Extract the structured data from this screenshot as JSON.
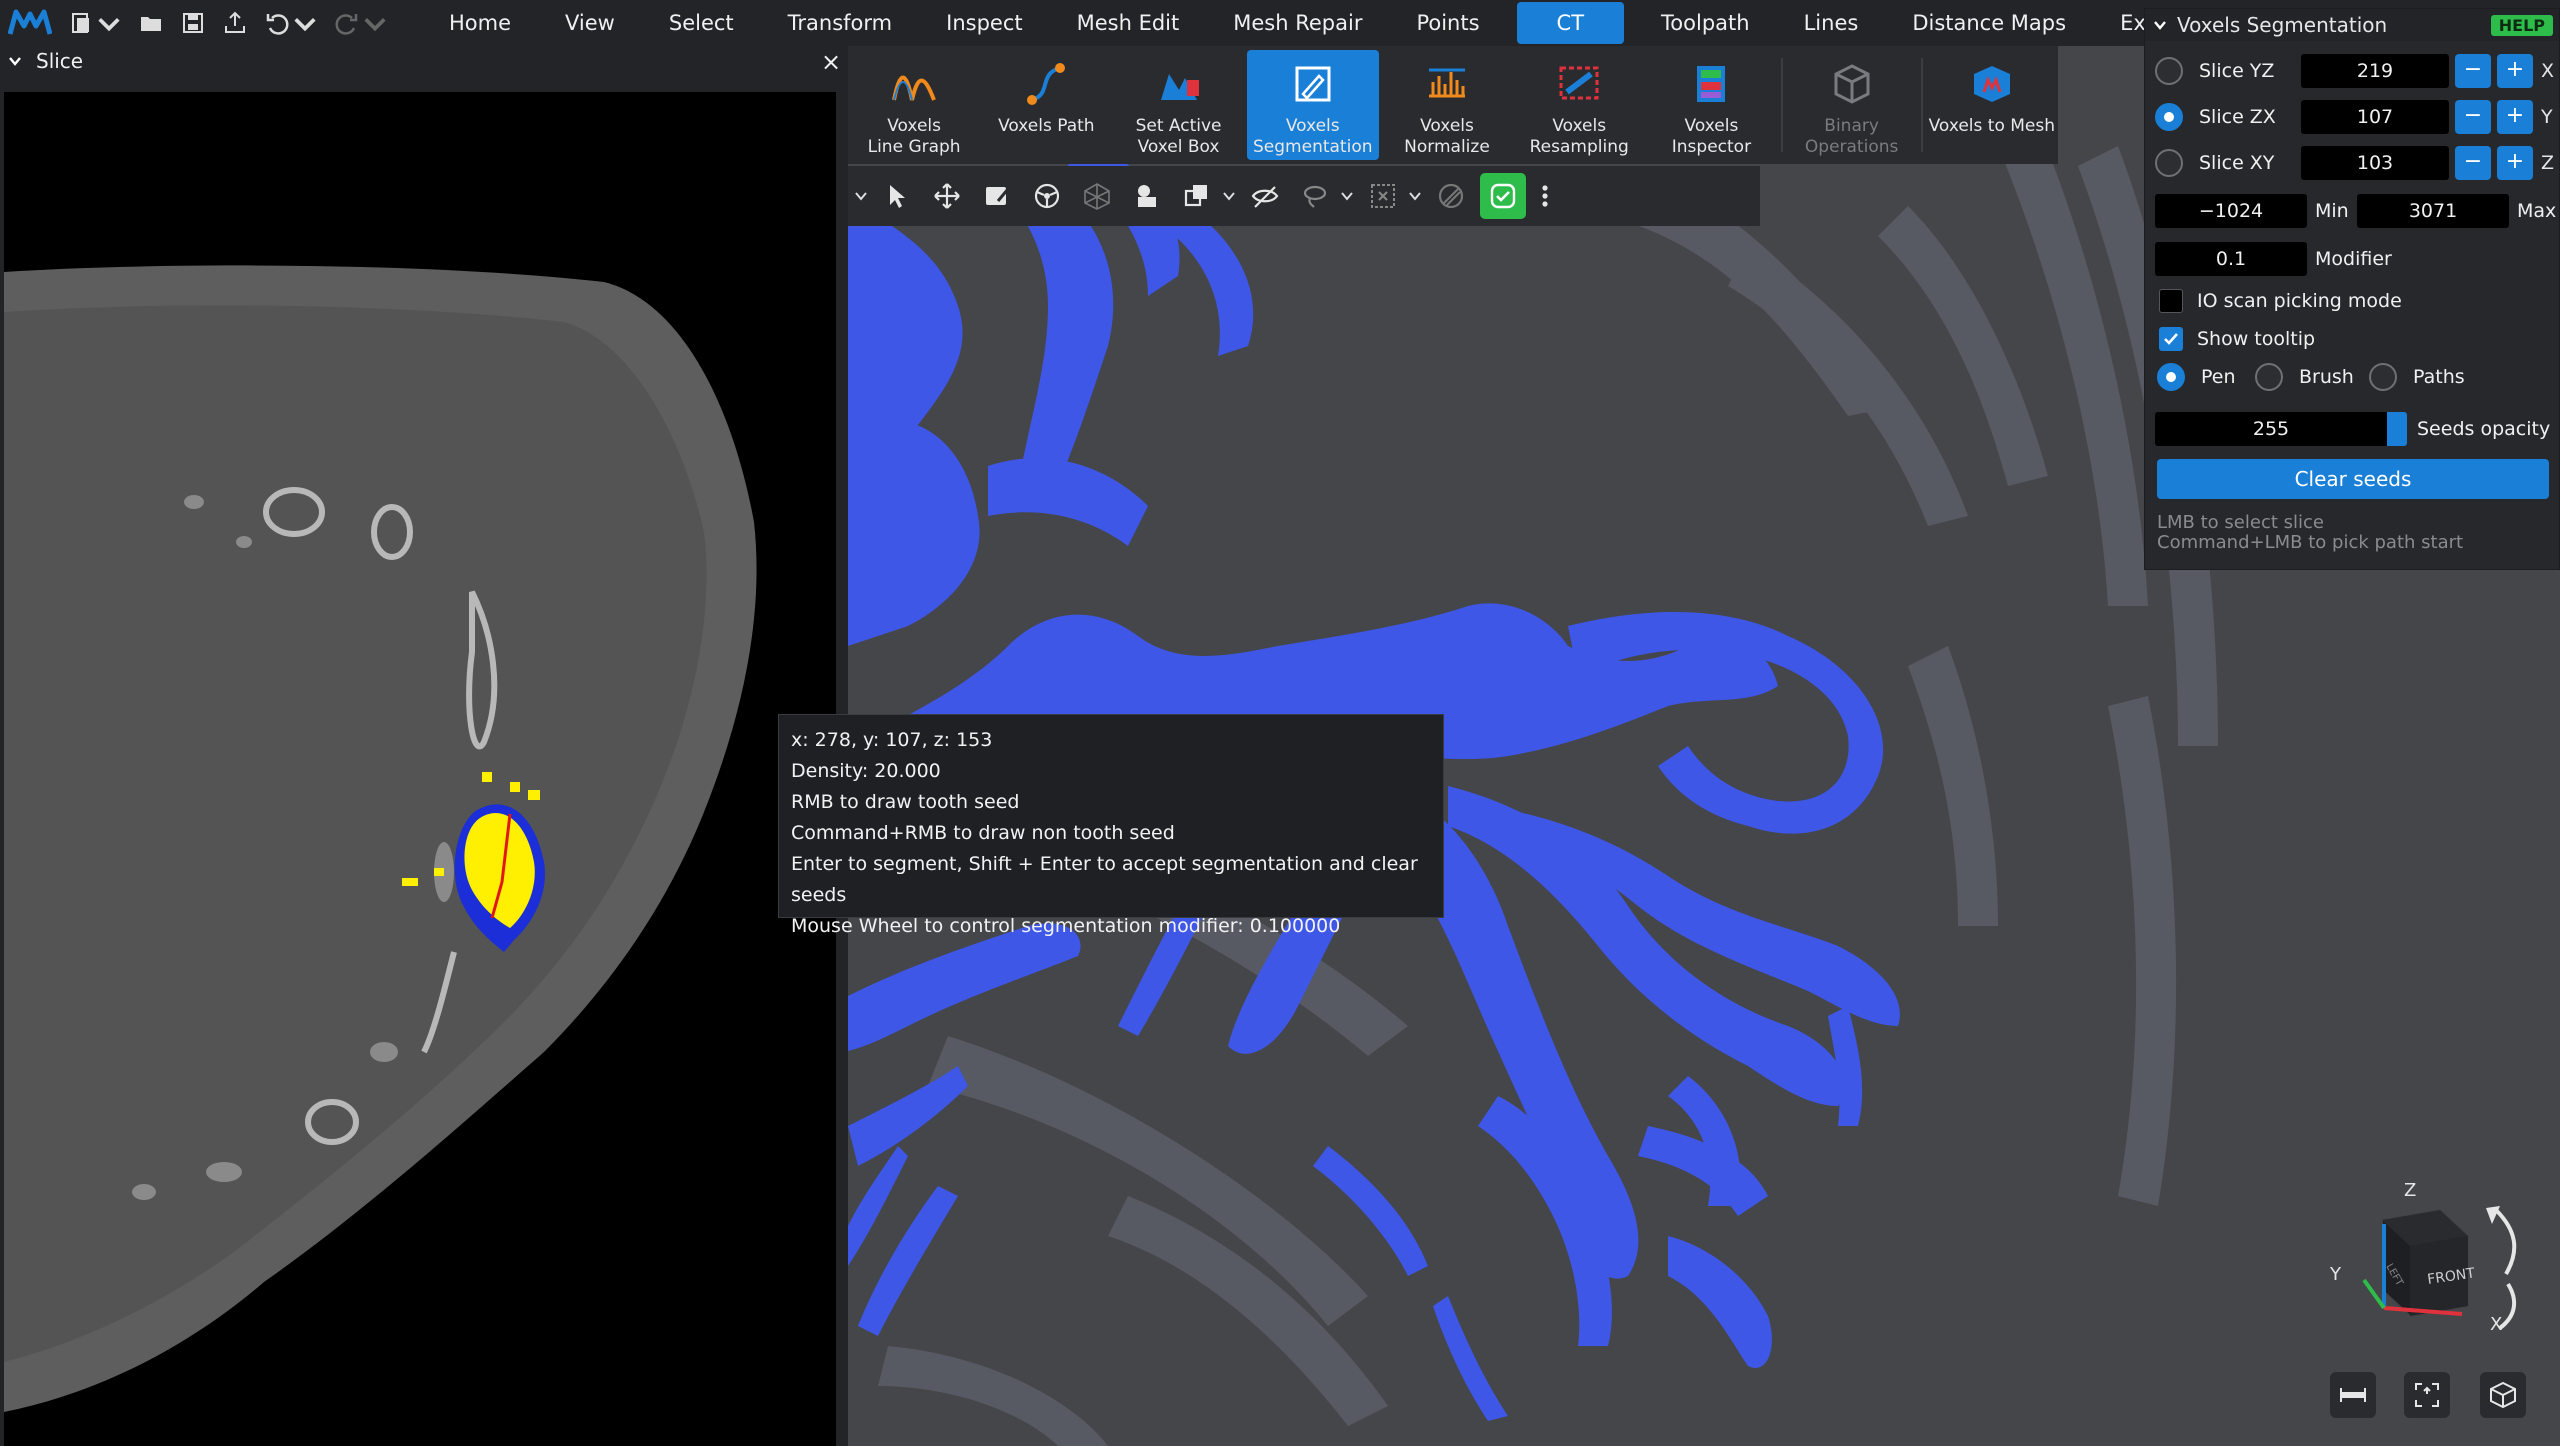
{
  "menubar": {
    "items": [
      "Home",
      "View",
      "Select",
      "Transform",
      "Inspect",
      "Mesh Edit",
      "Mesh Repair",
      "Points",
      "CT",
      "Toolpath",
      "Lines",
      "Distance Maps",
      "Experiment"
    ],
    "active": "CT"
  },
  "slice_panel": {
    "title": "Slice",
    "close_label": "×"
  },
  "ribbon": {
    "items": [
      {
        "label1": "Voxels",
        "label2": "Line Graph",
        "icon": "voxels-line-graph-icon"
      },
      {
        "label1": "Voxels Path",
        "label2": "",
        "icon": "voxels-path-icon"
      },
      {
        "label1": "Set Active",
        "label2": "Voxel Box",
        "icon": "set-active-voxel-box-icon"
      },
      {
        "label1": "Voxels",
        "label2": "Segmentation",
        "icon": "voxels-segmentation-icon"
      },
      {
        "label1": "Voxels",
        "label2": "Normalize",
        "icon": "voxels-normalize-icon"
      },
      {
        "label1": "Voxels",
        "label2": "Resampling",
        "icon": "voxels-resampling-icon"
      },
      {
        "label1": "Voxels",
        "label2": "Inspector",
        "icon": "voxels-inspector-icon"
      },
      {
        "label1": "Binary",
        "label2": "Operations",
        "icon": "binary-operations-icon"
      },
      {
        "label1": "Voxels to Mesh",
        "label2": "",
        "icon": "voxels-to-mesh-icon"
      }
    ]
  },
  "tooltip": {
    "lines": [
      "x: 278, y: 107, z: 153",
      "Density: 20.000",
      "RMB to draw tooth seed",
      "Command+RMB to draw non tooth seed",
      "Enter to segment, Shift + Enter to accept segmentation and clear seeds",
      "Mouse Wheel to control segmentation modifier: 0.100000"
    ]
  },
  "seg_panel": {
    "title": "Voxels Segmentation",
    "help": "HELP",
    "slices": [
      {
        "label": "Slice YZ",
        "value": "219",
        "axis": "X",
        "selected": false
      },
      {
        "label": "Slice ZX",
        "value": "107",
        "axis": "Y",
        "selected": true
      },
      {
        "label": "Slice XY",
        "value": "103",
        "axis": "Z",
        "selected": false
      }
    ],
    "minus": "−",
    "plus": "+",
    "min_value": "−1024",
    "min_label": "Min",
    "max_value": "3071",
    "max_label": "Max",
    "modifier_value": "0.1",
    "modifier_label": "Modifier",
    "io_scan_label": "IO scan picking mode",
    "io_scan_checked": false,
    "tooltip_label": "Show tooltip",
    "tooltip_checked": true,
    "modes": [
      {
        "label": "Pen",
        "selected": true
      },
      {
        "label": "Brush",
        "selected": false
      },
      {
        "label": "Paths",
        "selected": false
      }
    ],
    "seeds_opacity_value": "255",
    "seeds_opacity_label": "Seeds opacity",
    "clear_seeds": "Clear seeds",
    "hint1": "LMB to select slice",
    "hint2": "Command+LMB to pick path start"
  },
  "view_cube": {
    "face_label": "FRONT",
    "left_label": "LEFT",
    "z_label": "Z",
    "y_label": "Y",
    "x_label": "X"
  },
  "colors": {
    "accent": "#1a7fd6",
    "mesh": "#3f57e6",
    "seed_yellow": "#ffef00",
    "green": "#2ebd4a"
  }
}
